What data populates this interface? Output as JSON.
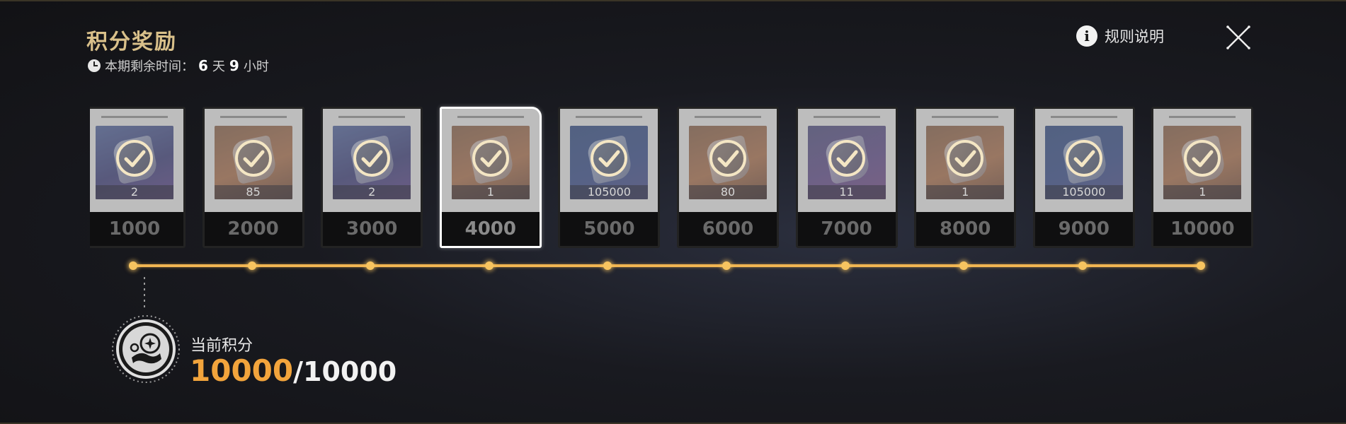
{
  "header": {
    "title": "积分奖励",
    "timer_label": "本期剩余时间：",
    "timer_days": "6",
    "timer_days_unit": "天",
    "timer_hours": "9",
    "timer_hours_unit": "小时",
    "rules_label": "规则说明"
  },
  "rewards": [
    {
      "quantity": "2",
      "points": "1000",
      "claimed": true,
      "theme": "blue"
    },
    {
      "quantity": "85",
      "points": "2000",
      "claimed": true,
      "theme": "orange"
    },
    {
      "quantity": "2",
      "points": "3000",
      "claimed": true,
      "theme": "blue"
    },
    {
      "quantity": "1",
      "points": "4000",
      "claimed": true,
      "theme": "orange",
      "selected": true
    },
    {
      "quantity": "105000",
      "points": "5000",
      "claimed": true,
      "theme": "navy"
    },
    {
      "quantity": "80",
      "points": "6000",
      "claimed": true,
      "theme": "orange"
    },
    {
      "quantity": "11",
      "points": "7000",
      "claimed": true,
      "theme": "purple"
    },
    {
      "quantity": "1",
      "points": "8000",
      "claimed": true,
      "theme": "orange"
    },
    {
      "quantity": "105000",
      "points": "9000",
      "claimed": true,
      "theme": "navy"
    },
    {
      "quantity": "1",
      "points": "10000",
      "claimed": true,
      "theme": "orange"
    }
  ],
  "progress": {
    "label": "当前积分",
    "current": "10000",
    "separator": "/",
    "max": "10000",
    "fill_fraction": 1.0
  },
  "colors": {
    "accent_gold": "#f2a43c",
    "title_gold": "#d9c08a",
    "track": "#f1b552"
  },
  "icons": {
    "clock": "clock-icon",
    "info": "info-icon",
    "close": "close-icon",
    "check": "check-icon",
    "score": "score-emblem-icon"
  }
}
